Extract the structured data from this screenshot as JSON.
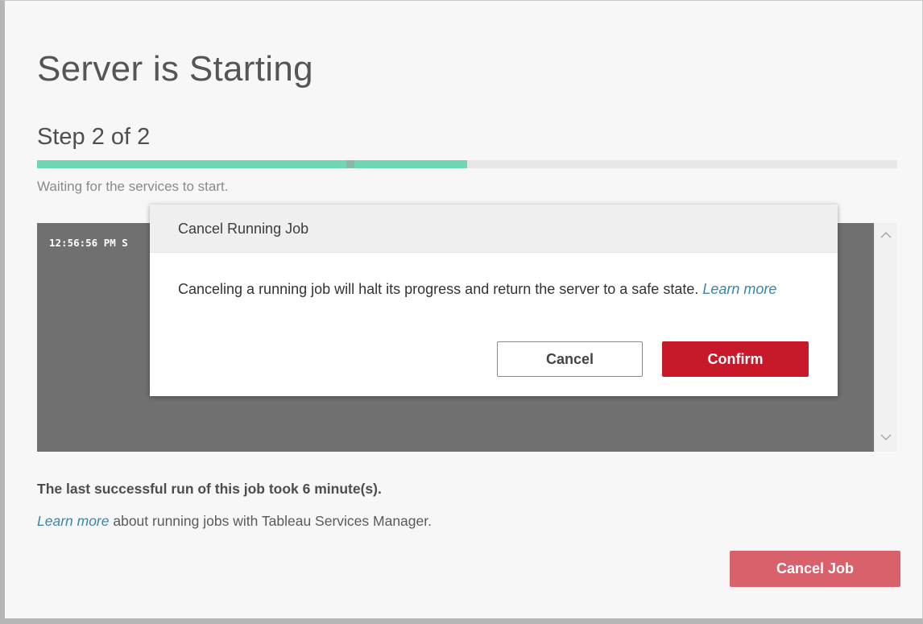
{
  "page": {
    "title": "Server is Starting"
  },
  "step": {
    "title": "Step 2 of 2",
    "status": "Waiting for the services to start.",
    "progress_fraction": 0.5,
    "progress_marker_fraction": 0.36,
    "progress_color": "#6ed6b0"
  },
  "log": {
    "lines": [
      "12:56:56 PM S"
    ]
  },
  "modal": {
    "title": "Cancel Running Job",
    "body_text": "Canceling a running job will halt its progress and return the server to a safe state. ",
    "body_link": "Learn more",
    "cancel_label": "Cancel",
    "confirm_label": "Confirm",
    "confirm_color": "#c8192a"
  },
  "footer": {
    "last_run_text": "The last successful run of this job took 6 minute(s).",
    "learn_more_link": "Learn more",
    "learn_more_suffix": " about running jobs with Tableau Services Manager.",
    "cancel_job_label": "Cancel Job",
    "cancel_job_color": "#d9616b"
  },
  "icons": {
    "scroll_up": "chevron-up-icon",
    "scroll_down": "chevron-down-icon"
  }
}
